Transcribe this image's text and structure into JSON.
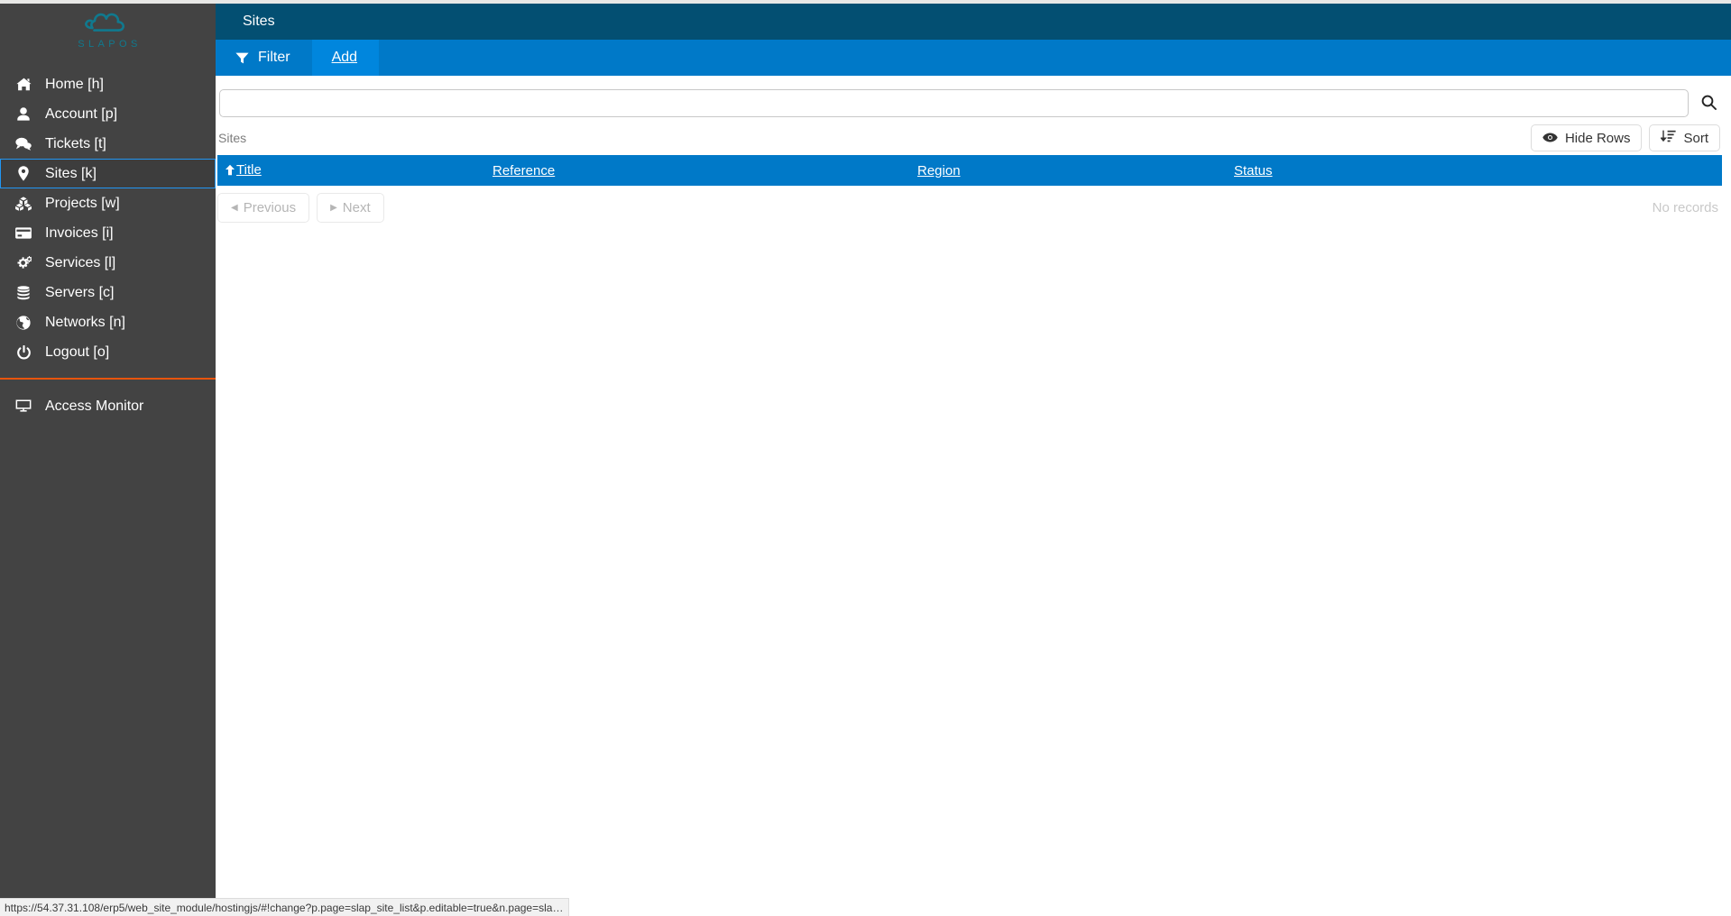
{
  "brand": {
    "logo_icon": "slapos-cloud-logo",
    "logo_text": "SLAPOS",
    "logo_color": "#10798e"
  },
  "sidebar": {
    "accent_color": "#e8540d",
    "active_border_color": "#2196f3",
    "background": "#434343",
    "items": [
      {
        "label": "Home [h]",
        "icon": "home-icon",
        "active": false
      },
      {
        "label": "Account [p]",
        "icon": "user-icon",
        "active": false
      },
      {
        "label": "Tickets [t]",
        "icon": "comments-icon",
        "active": false
      },
      {
        "label": "Sites [k]",
        "icon": "map-marker-icon",
        "active": true
      },
      {
        "label": "Projects [w]",
        "icon": "cubes-icon",
        "active": false
      },
      {
        "label": "Invoices [i]",
        "icon": "credit-card-icon",
        "active": false
      },
      {
        "label": "Services [l]",
        "icon": "cogs-icon",
        "active": false
      },
      {
        "label": "Servers [c]",
        "icon": "database-icon",
        "active": false
      },
      {
        "label": "Networks [n]",
        "icon": "globe-icon",
        "active": false
      },
      {
        "label": "Logout [o]",
        "icon": "power-off-icon",
        "active": false
      }
    ],
    "bottom_items": [
      {
        "label": "Access Monitor",
        "icon": "desktop-icon"
      }
    ]
  },
  "header": {
    "title": "Sites",
    "background": "#034f72"
  },
  "tabs": {
    "background": "#0079c8",
    "selected_background": "#0086dd",
    "items": [
      {
        "label": "Filter",
        "icon": "filter-icon",
        "selected": false,
        "underline": false
      },
      {
        "label": "Add",
        "icon": "",
        "selected": true,
        "underline": true
      }
    ]
  },
  "search": {
    "value": "",
    "placeholder": "",
    "button_icon": "search-icon"
  },
  "listbox": {
    "title": "Sites",
    "actions": [
      {
        "label": "Hide Rows",
        "icon": "eye-icon"
      },
      {
        "label": "Sort",
        "icon": "sort-amount-desc-icon"
      }
    ],
    "header_background": "#0079c8",
    "columns": [
      {
        "label": "Title",
        "sorted": true,
        "sort_direction": "asc",
        "sort_icon": "arrow-up-icon"
      },
      {
        "label": "Reference",
        "sorted": false,
        "sort_direction": "",
        "sort_icon": ""
      },
      {
        "label": "Region",
        "sorted": false,
        "sort_direction": "",
        "sort_icon": ""
      },
      {
        "label": "Status",
        "sorted": false,
        "sort_direction": "",
        "sort_icon": ""
      }
    ],
    "rows": [],
    "empty_text": "No records"
  },
  "pager": {
    "previous": {
      "label": "Previous",
      "icon": "caret-left-icon",
      "disabled": true
    },
    "next": {
      "label": "Next",
      "icon": "caret-right-icon",
      "disabled": true
    }
  },
  "status_bar": {
    "url": "https://54.37.31.108/erp5/web_site_module/hostingjs/#!change?p.page=slap_site_list&p.editable=true&n.page=sla…"
  }
}
